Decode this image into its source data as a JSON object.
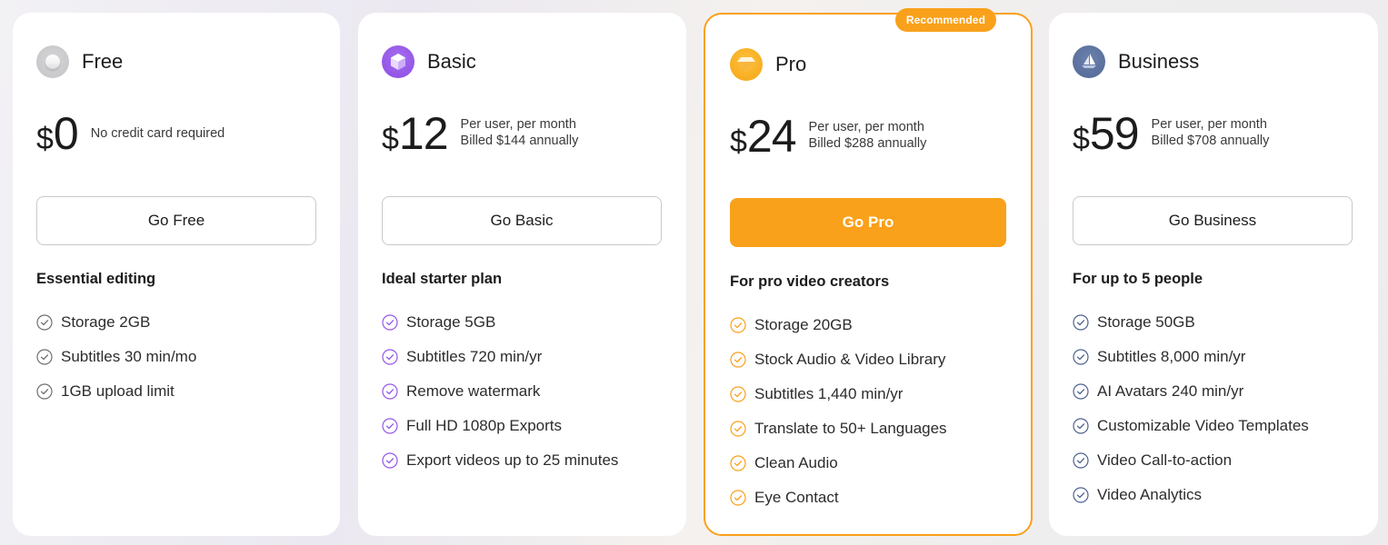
{
  "colors": {
    "accent_orange": "#f9a11b",
    "free_check": "#6e6e73",
    "basic_check": "#9357e6",
    "pro_check": "#f9a11b",
    "business_check": "#4d6290"
  },
  "plans": [
    {
      "id": "free",
      "name": "Free",
      "icon": "toggle-knob-icon",
      "currency": "$",
      "price": "0",
      "price_note_line1": "No credit card required",
      "price_note_line2": "",
      "cta_label": "Go Free",
      "tagline": "Essential editing",
      "features": [
        "Storage 2GB",
        "Subtitles 30 min/mo",
        "1GB upload limit"
      ]
    },
    {
      "id": "basic",
      "name": "Basic",
      "icon": "cube-icon",
      "currency": "$",
      "price": "12",
      "price_note_line1": "Per user, per month",
      "price_note_line2": "Billed $144 annually",
      "cta_label": "Go Basic",
      "tagline": "Ideal starter plan",
      "features": [
        "Storage 5GB",
        "Subtitles 720 min/yr",
        "Remove watermark",
        "Full HD 1080p Exports",
        "Export videos up to 25 minutes"
      ]
    },
    {
      "id": "pro",
      "name": "Pro",
      "icon": "diamond-icon",
      "badge": "Recommended",
      "currency": "$",
      "price": "24",
      "price_note_line1": "Per user, per month",
      "price_note_line2": "Billed $288 annually",
      "cta_label": "Go Pro",
      "tagline": "For pro video creators",
      "features": [
        "Storage 20GB",
        "Stock Audio & Video Library",
        "Subtitles 1,440 min/yr",
        "Translate to 50+ Languages",
        "Clean Audio",
        "Eye Contact"
      ]
    },
    {
      "id": "business",
      "name": "Business",
      "icon": "sailboat-icon",
      "currency": "$",
      "price": "59",
      "price_note_line1": "Per user, per month",
      "price_note_line2": "Billed $708 annually",
      "cta_label": "Go Business",
      "tagline": "For up to 5 people",
      "features": [
        "Storage 50GB",
        "Subtitles 8,000 min/yr",
        "AI Avatars 240 min/yr",
        "Customizable Video Templates",
        "Video Call-to-action",
        "Video Analytics"
      ]
    }
  ]
}
